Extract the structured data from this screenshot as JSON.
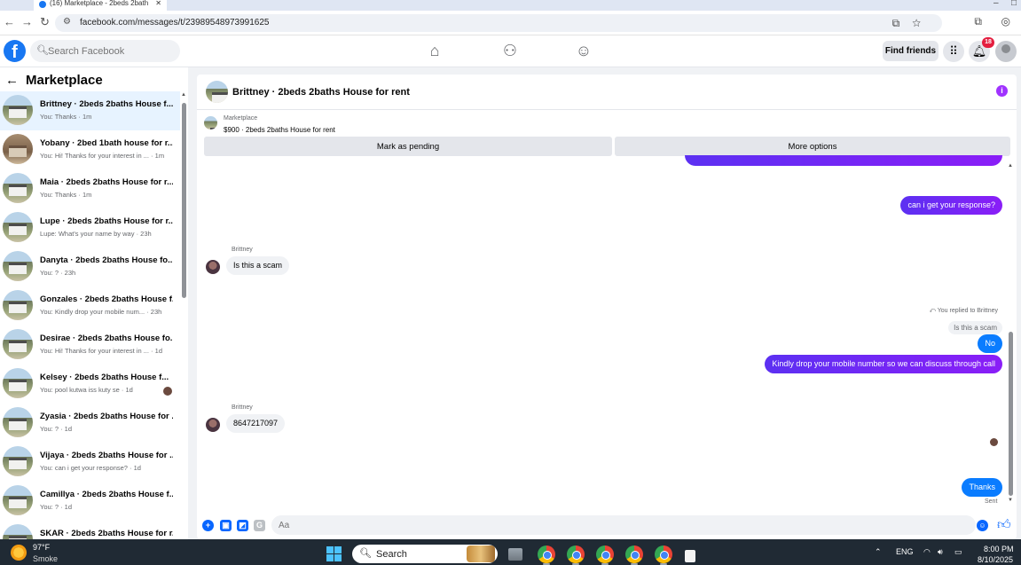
{
  "browser": {
    "tab_title": "(16) Marketplace - 2beds 2bath",
    "url": "facebook.com/messages/t/23989548973991625"
  },
  "topbar": {
    "logo": "f",
    "search_placeholder": "Search Facebook",
    "find_friends_label": "Find friends",
    "notification_count": "18",
    "nav_icons": [
      "home-icon",
      "friends-icon",
      "groups-icon"
    ]
  },
  "sidebar": {
    "title": "Marketplace",
    "conversations": [
      {
        "title": "Brittney · 2beds 2baths House f...",
        "subtitle": "You: Thanks · 1m"
      },
      {
        "title": "Yobany · 2bed 1bath house for r...",
        "subtitle": "You: Hi! Thanks for your interest in ... · 1m"
      },
      {
        "title": "Maia · 2beds 2baths House for r...",
        "subtitle": "You: Thanks · 1m"
      },
      {
        "title": "Lupe · 2beds 2baths House for r...",
        "subtitle": "Lupe: What's your name by way · 23h"
      },
      {
        "title": "Danyta · 2beds 2baths House fo...",
        "subtitle": "You: ? · 23h"
      },
      {
        "title": "Gonzales · 2beds 2baths House f...",
        "subtitle": "You: Kindly drop your mobile num... · 23h"
      },
      {
        "title": "Desirae · 2beds 2baths House fo...",
        "subtitle": "You: Hi! Thanks for your interest in ... · 1d"
      },
      {
        "title": "Kelsey · 2beds 2baths House f...",
        "subtitle": "You: pool kutwa iss kuty se · 1d"
      },
      {
        "title": "Zyasia · 2beds 2baths House for ...",
        "subtitle": "You: ? · 1d"
      },
      {
        "title": "Vijaya · 2beds 2baths House for ...",
        "subtitle": "You: can i get your response? · 1d"
      },
      {
        "title": "Camillya · 2beds 2baths House f...",
        "subtitle": "You: ? · 1d"
      },
      {
        "title": "SKAR · 2beds 2baths House for r...",
        "subtitle": ""
      }
    ]
  },
  "chat": {
    "title": "Brittney · 2beds 2baths House for rent",
    "listing_label": "Marketplace",
    "listing_price": "$900 · 2beds 2baths House for rent",
    "mark_pending_label": "Mark as pending",
    "more_options_label": "More options",
    "messages": {
      "out_1": "can i get your response?",
      "sender_1": "Brittney",
      "in_1": "Is this a scam",
      "replied_to": "You replied to Brittney",
      "quoted": "Is this a scam",
      "out_2": "No",
      "out_3": "Kindly drop your mobile number so we can discuss through call",
      "sender_2": "Brittney",
      "in_2": "8647217097",
      "out_4": "Thanks",
      "status": "Sent"
    },
    "input_placeholder": "Aa"
  },
  "taskbar": {
    "temperature": "97°F",
    "weather": "Smoke",
    "search_label": "Search",
    "language": "ENG",
    "time": "8:00 PM",
    "date": "8/10/2025"
  },
  "colors": {
    "fb_blue": "#1877f2",
    "message_purple": "#7b1fff",
    "message_blue": "#0a7cff",
    "taskbar": "#202a34"
  }
}
